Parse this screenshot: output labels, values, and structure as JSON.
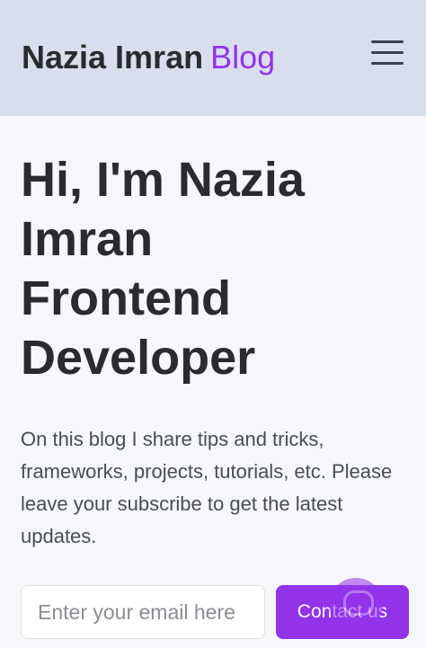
{
  "header": {
    "brand_name": "Nazia Imran",
    "brand_accent": "Blog",
    "menu_icon": "hamburger-menu-icon"
  },
  "hero": {
    "title_lines": [
      "Hi, I'm Nazia",
      "Imran",
      "Frontend",
      "Developer"
    ],
    "description": "On this blog I share tips and tricks, frameworks, projects, tutorials, etc. Please leave your subscribe to get the latest updates."
  },
  "subscribe": {
    "email_placeholder": "Enter your email here",
    "email_value": "",
    "contact_label": "Contact us"
  },
  "chat_widget": {
    "icon": "chat-bubble-icon"
  },
  "colors": {
    "accent": "#9333ea",
    "header_bg": "#d9deed",
    "page_bg": "#f6f7fb",
    "text": "#292b2f"
  }
}
